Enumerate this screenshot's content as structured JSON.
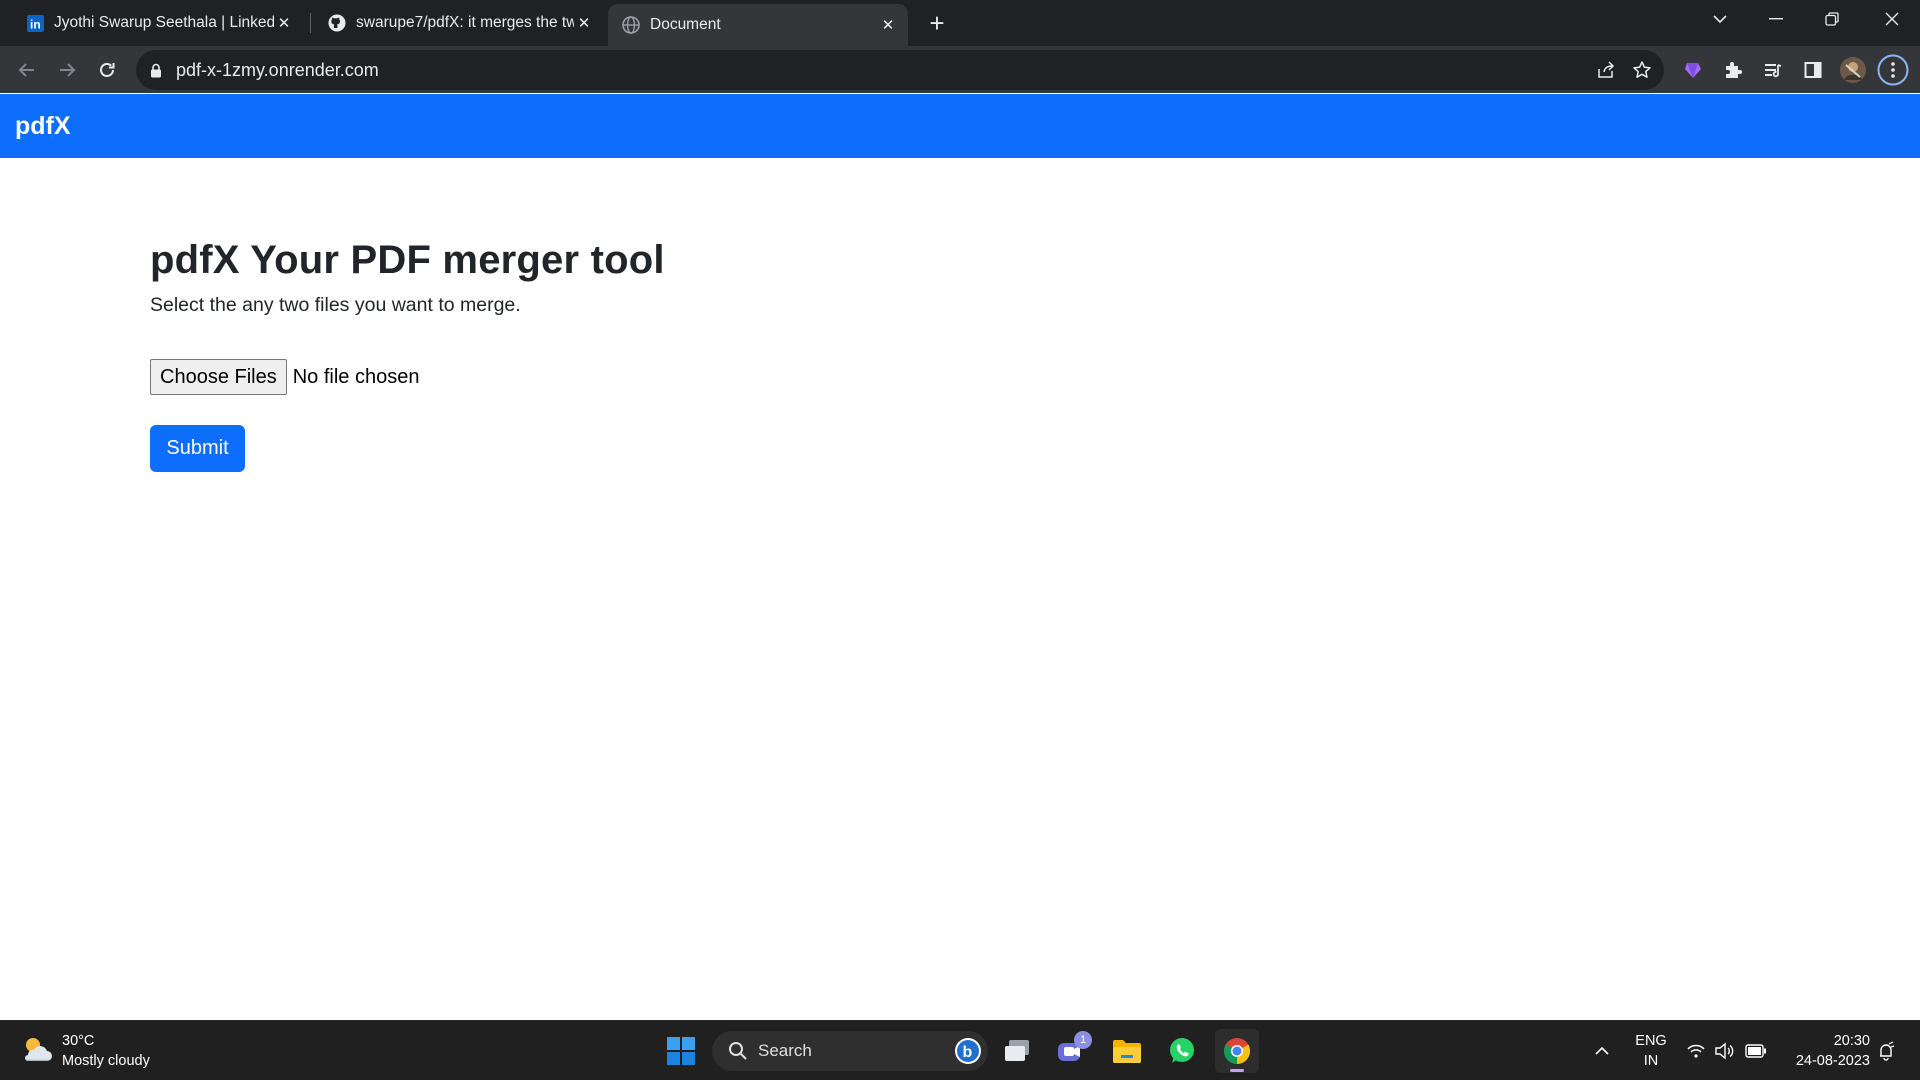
{
  "browser": {
    "tabs": [
      {
        "title": "Jyothi Swarup Seethala | LinkedIn",
        "favicon": "linkedin-icon",
        "active": false
      },
      {
        "title": "swarupe7/pdfX: it merges the tw",
        "favicon": "github-icon",
        "active": false
      },
      {
        "title": "Document",
        "favicon": "globe-icon",
        "active": true
      }
    ],
    "url": "pdf-x-1zmy.onrender.com"
  },
  "page": {
    "brand": "pdfX",
    "title": "pdfX Your PDF merger tool",
    "subtitle": "Select the any two files you want to merge.",
    "file_button": "Choose Files",
    "file_status": "No file chosen",
    "submit": "Submit"
  },
  "taskbar": {
    "weather_temp": "30°C",
    "weather_desc": "Mostly cloudy",
    "search_label": "Search",
    "teams_badge": "1",
    "language": "ENG",
    "region": "IN",
    "time": "20:30",
    "date": "24-08-2023"
  },
  "colors": {
    "primary": "#0d6efd",
    "chrome_dark": "#202124",
    "chrome_toolbar": "#35363a",
    "taskbar": "#202020"
  }
}
